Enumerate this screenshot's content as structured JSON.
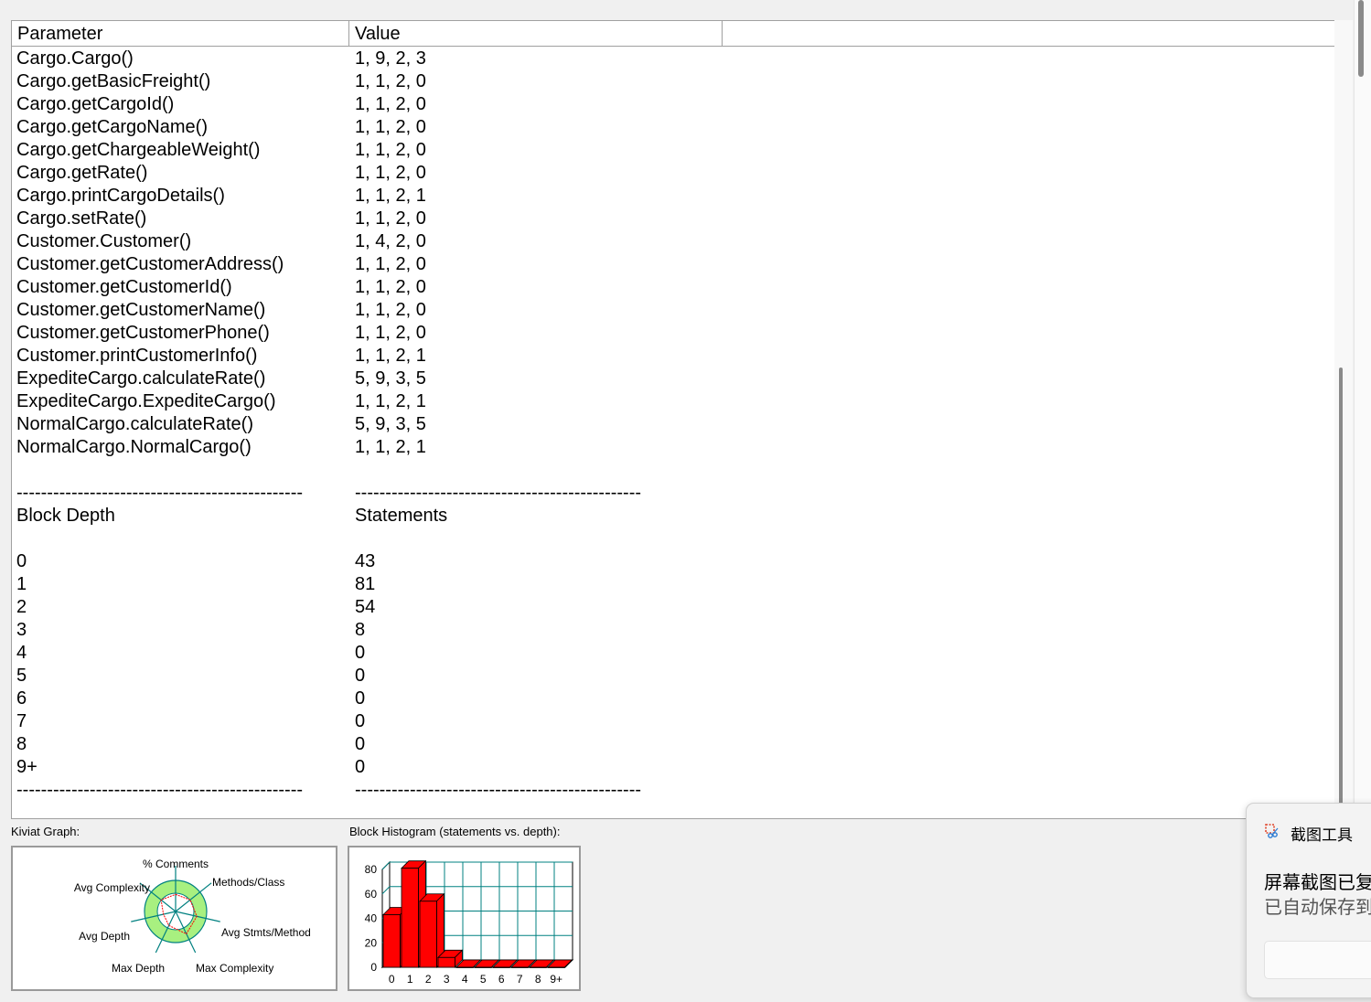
{
  "table": {
    "headers": [
      "Parameter",
      "Value"
    ],
    "rows": [
      [
        "Cargo.Cargo()",
        "1, 9, 2, 3"
      ],
      [
        "Cargo.getBasicFreight()",
        "1, 1, 2, 0"
      ],
      [
        "Cargo.getCargoId()",
        "1, 1, 2, 0"
      ],
      [
        "Cargo.getCargoName()",
        "1, 1, 2, 0"
      ],
      [
        "Cargo.getChargeableWeight()",
        "1, 1, 2, 0"
      ],
      [
        "Cargo.getRate()",
        "1, 1, 2, 0"
      ],
      [
        "Cargo.printCargoDetails()",
        "1, 1, 2, 1"
      ],
      [
        "Cargo.setRate()",
        "1, 1, 2, 0"
      ],
      [
        "Customer.Customer()",
        "1, 4, 2, 0"
      ],
      [
        "Customer.getCustomerAddress()",
        "1, 1, 2, 0"
      ],
      [
        "Customer.getCustomerId()",
        "1, 1, 2, 0"
      ],
      [
        "Customer.getCustomerName()",
        "1, 1, 2, 0"
      ],
      [
        "Customer.getCustomerPhone()",
        "1, 1, 2, 0"
      ],
      [
        "Customer.printCustomerInfo()",
        "1, 1, 2, 1"
      ],
      [
        "ExpediteCargo.calculateRate()",
        "5, 9, 3, 5"
      ],
      [
        "ExpediteCargo.ExpediteCargo()",
        "1, 1, 2, 1"
      ],
      [
        "NormalCargo.calculateRate()",
        "5, 9, 3, 5"
      ],
      [
        "NormalCargo.NormalCargo()",
        "1, 1, 2, 1"
      ],
      [
        "",
        ""
      ],
      [
        "-----------------------------------------------",
        "-----------------------------------------------"
      ],
      [
        "Block Depth",
        "Statements"
      ],
      [
        "",
        ""
      ],
      [
        "0",
        "43"
      ],
      [
        "1",
        "81"
      ],
      [
        "2",
        "54"
      ],
      [
        "3",
        "8"
      ],
      [
        "4",
        "0"
      ],
      [
        "5",
        "0"
      ],
      [
        "6",
        "0"
      ],
      [
        "7",
        "0"
      ],
      [
        "8",
        "0"
      ],
      [
        "9+",
        "0"
      ],
      [
        "-----------------------------------------------",
        "-----------------------------------------------"
      ]
    ]
  },
  "kiviat": {
    "label": "Kiviat Graph:",
    "axes": [
      "% Comments",
      "Methods/Class",
      "Avg Stmts/Method",
      "Max Complexity",
      "Max Depth",
      "Avg Depth",
      "Avg Complexity"
    ],
    "band_color": "#a8f080",
    "axis_color": "#008080",
    "polygon_color": "#ff0000"
  },
  "histogram": {
    "label": "Block Histogram (statements vs. depth):",
    "bar_color": "#ff0000",
    "grid_color": "#008080"
  },
  "chart_data": {
    "type": "bar",
    "categories": [
      "0",
      "1",
      "2",
      "3",
      "4",
      "5",
      "6",
      "7",
      "8",
      "9+"
    ],
    "values": [
      43,
      81,
      54,
      8,
      0,
      0,
      0,
      0,
      0,
      0
    ],
    "ylim": [
      0,
      80
    ],
    "yticks": [
      "0",
      "20",
      "40",
      "60",
      "80"
    ]
  },
  "toast": {
    "app_name": "截图工具",
    "title": "屏幕截图已复",
    "body": "已自动保存到",
    "icon": "snipping-tool-icon"
  }
}
